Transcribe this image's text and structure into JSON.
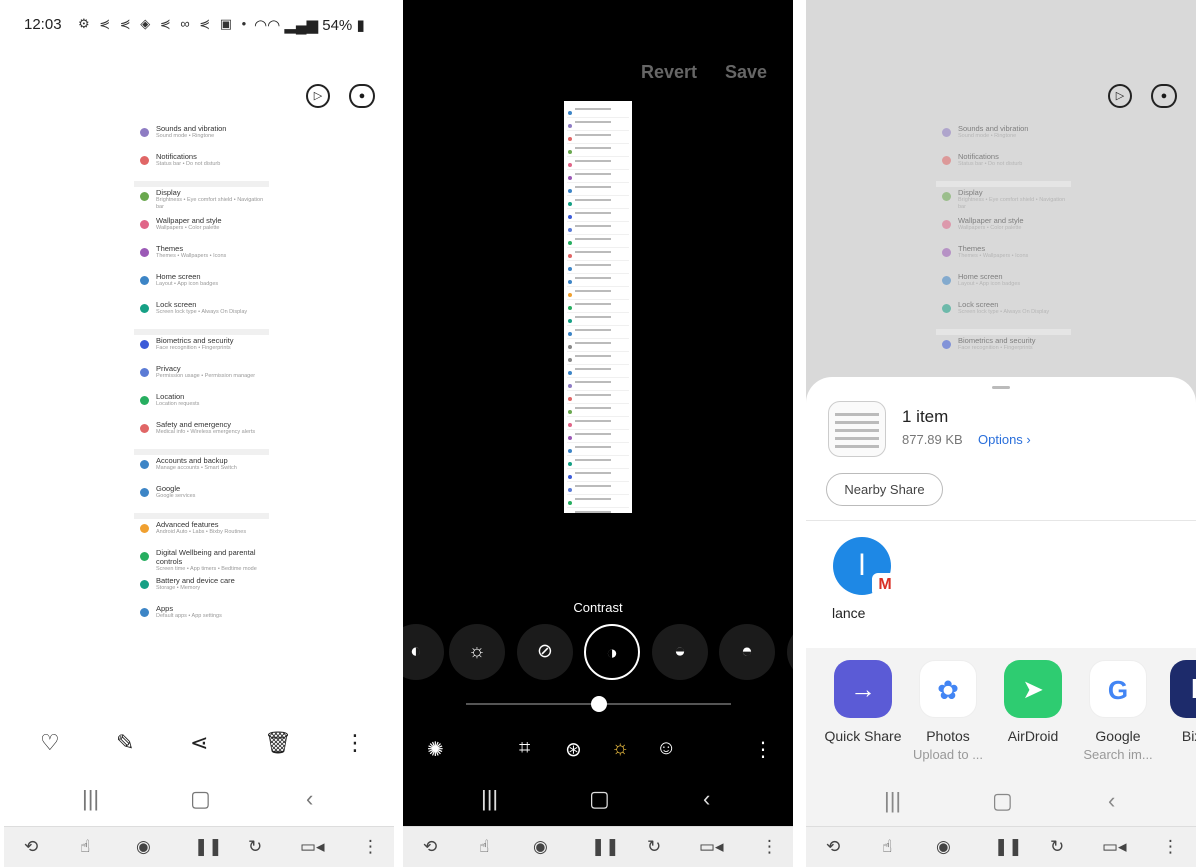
{
  "panel1": {
    "status_time": "12:03",
    "status_icons": "⚙ ⋞ ⋞ ◈ ⋞ ∞ ⋞ ▣ •",
    "status_right": "54%",
    "settings_items": [
      {
        "title": "Sounds and vibration",
        "sub": "Sound mode • Ringtone",
        "color": "#8e7cc3"
      },
      {
        "title": "Notifications",
        "sub": "Status bar • Do not disturb",
        "color": "#e06666"
      },
      {
        "title": "Display",
        "sub": "Brightness • Eye comfort shield • Navigation bar",
        "color": "#6aa84f"
      },
      {
        "title": "Wallpaper and style",
        "sub": "Wallpapers • Color palette",
        "color": "#e06688"
      },
      {
        "title": "Themes",
        "sub": "Themes • Wallpapers • Icons",
        "color": "#9b59b6"
      },
      {
        "title": "Home screen",
        "sub": "Layout • App icon badges",
        "color": "#3d85c6"
      },
      {
        "title": "Lock screen",
        "sub": "Screen lock type • Always On Display",
        "color": "#16a085"
      },
      {
        "title": "Biometrics and security",
        "sub": "Face recognition • Fingerprints",
        "color": "#3c5bd8"
      },
      {
        "title": "Privacy",
        "sub": "Permission usage • Permission manager",
        "color": "#5b7bd5"
      },
      {
        "title": "Location",
        "sub": "Location requests",
        "color": "#27ae60"
      },
      {
        "title": "Safety and emergency",
        "sub": "Medical info • Wireless emergency alerts",
        "color": "#e06666"
      },
      {
        "title": "Accounts and backup",
        "sub": "Manage accounts • Smart Switch",
        "color": "#3d85c6"
      },
      {
        "title": "Google",
        "sub": "Google services",
        "color": "#3d85c6"
      },
      {
        "title": "Advanced features",
        "sub": "Android Auto • Labs • Bixby Routines",
        "color": "#f0a030"
      },
      {
        "title": "Digital Wellbeing and parental controls",
        "sub": "Screen time • App timers • Bedtime mode",
        "color": "#27ae60"
      },
      {
        "title": "Battery and device care",
        "sub": "Storage • Memory",
        "color": "#16a085"
      },
      {
        "title": "Apps",
        "sub": "Default apps • App settings",
        "color": "#3d85c6"
      }
    ]
  },
  "panel2": {
    "revert": "Revert",
    "save": "Save",
    "contrast_label": "Contrast"
  },
  "panel3": {
    "item_title": "1 item",
    "item_size": "877.89 KB",
    "item_options": "Options ›",
    "nearby_share": "Nearby Share",
    "contact_initial": "l",
    "contact_name": "lance",
    "apps": [
      {
        "name": "Quick Share",
        "sub": "",
        "color": "#5b5bd6",
        "glyph": "→"
      },
      {
        "name": "Photos",
        "sub": "Upload to ...",
        "color": "#ffffff",
        "glyph": "✿"
      },
      {
        "name": "AirDroid",
        "sub": "",
        "color": "#2ecc71",
        "glyph": "➤"
      },
      {
        "name": "Google",
        "sub": "Search im...",
        "color": "#ffffff",
        "glyph": "G"
      },
      {
        "name": "Bixby",
        "sub": "",
        "color": "#1d2b6b",
        "glyph": "b"
      }
    ]
  }
}
